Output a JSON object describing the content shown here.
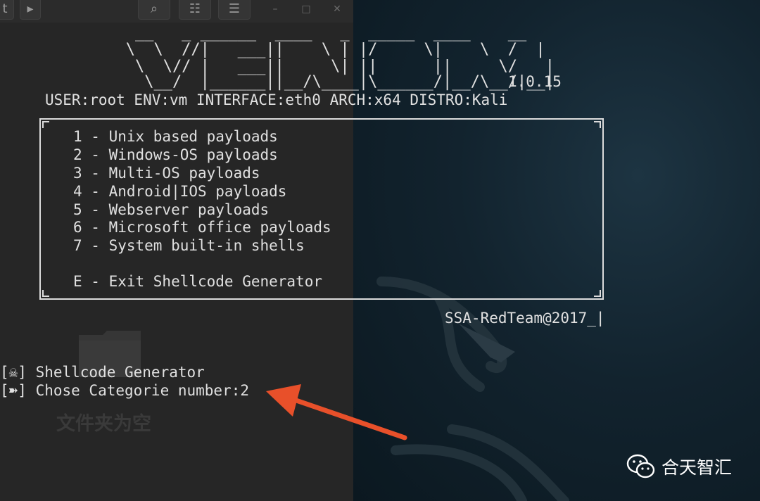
{
  "file_manager": {
    "toolbar": {
      "partial_label": "t",
      "next_glyph": "▸",
      "search_glyph": "⌕",
      "view_glyph": "☷",
      "menu_glyph": "☰",
      "minimize_glyph": "–",
      "maximize_glyph": "□",
      "close_glyph": "✕"
    },
    "empty_folder_label": "文件夹为空"
  },
  "terminal": {
    "banner": [
      "        __   _ ______  ____   _  _____  ____    __",
      "       \\  \\  //|   ___||    \\ | |/     \\|    \\  /  |",
      "        \\  \\// |   ___||     \\| ||      ||     \\/   |",
      "         \\__/  |______||__/\\____|\\______/|__/\\__/|__|"
    ],
    "version": "1.0.15",
    "env_line": "USER:root ENV:vm INTERFACE:eth0 ARCH:x64 DISTRO:Kali",
    "menu_items": [
      "1 - Unix based payloads",
      "2 - Windows-OS payloads",
      "3 - Multi-OS payloads",
      "4 - Android|IOS payloads",
      "5 - Webserver payloads",
      "6 - Microsoft office payloads",
      "7 - System built-in shells",
      "E - Exit Shellcode Generator"
    ],
    "signature": "SSA-RedTeam@2017_|",
    "prompt_title": "[☠] Shellcode Generator",
    "prompt_input": "[➽] Chose Categorie number:2"
  },
  "watermark": {
    "text": "合天智汇",
    "icon": "wechat-icon"
  },
  "colors": {
    "arrow": "#e8502a",
    "terminal_text": "#e0e0e0"
  }
}
